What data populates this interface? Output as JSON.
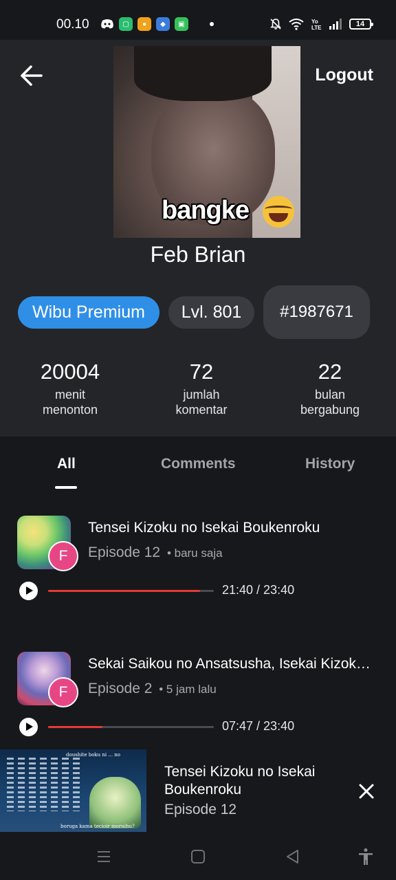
{
  "status_bar": {
    "time": "00.10",
    "battery": "14",
    "left_icons": [
      "discord-icon",
      "app-green-icon",
      "app-orange-icon",
      "app-blue-icon",
      "app-green2-icon"
    ],
    "right_icons": [
      "mute-bell-icon",
      "wifi-icon",
      "volte-icon",
      "signal-icon"
    ]
  },
  "header": {
    "logout_label": "Logout"
  },
  "profile": {
    "avatar_caption": "bangke",
    "name": "Feb Brian",
    "membership": "Wibu Premium",
    "level": "Lvl. 801",
    "user_id": "#1987671"
  },
  "stats": [
    {
      "value": "20004",
      "label_line1": "menit",
      "label_line2": "menonton"
    },
    {
      "value": "72",
      "label_line1": "jumlah",
      "label_line2": "komentar"
    },
    {
      "value": "22",
      "label_line1": "bulan",
      "label_line2": "bergabung"
    }
  ],
  "tabs": [
    {
      "label": "All",
      "active": true
    },
    {
      "label": "Comments",
      "active": false
    },
    {
      "label": "History",
      "active": false
    }
  ],
  "history": [
    {
      "title": "Tensei Kizoku no Isekai Boukenroku",
      "episode": "Episode 12",
      "time_ago": "• baru saja",
      "badge": "F",
      "progress_text": "21:40 / 23:40",
      "progress": 0.915
    },
    {
      "title": "Sekai Saikou no Ansatsusha, Isekai Kizoku ni Tensei suru",
      "episode": "Episode 2",
      "time_ago": "• 5 jam lalu",
      "badge": "F",
      "progress_text": "07:47 / 23:40",
      "progress": 0.329
    }
  ],
  "mini_player": {
    "title": "Tensei Kizoku no Isekai Boukenroku",
    "episode": "Episode 12",
    "thumb_caption_top": "doushite boku ni ... no",
    "thumb_caption_bottom": "boruga kama tecioir moruihu?"
  },
  "colors": {
    "accent_blue": "#2f8fe6",
    "progress_red": "#e53935",
    "badge_pink": "#e74685",
    "header_bg": "#242529",
    "page_bg": "#17181b"
  }
}
